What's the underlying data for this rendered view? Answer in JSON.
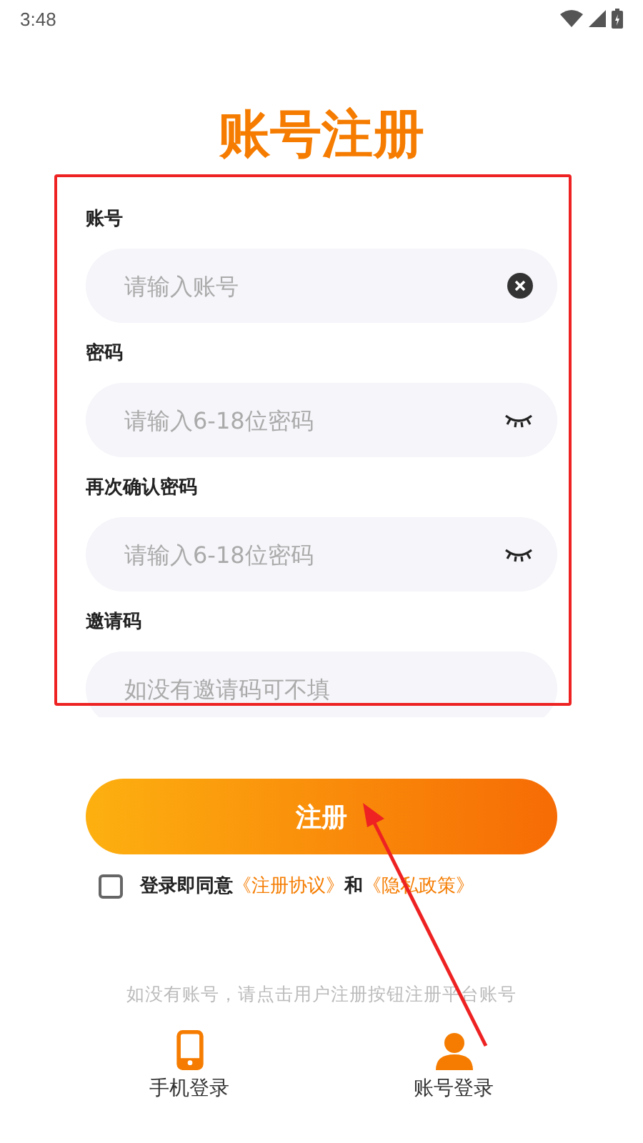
{
  "status_bar": {
    "time": "3:48"
  },
  "title": "账号注册",
  "fields": [
    {
      "kind": "clearable",
      "label": "账号",
      "placeholder": "请输入账号"
    },
    {
      "kind": "password",
      "label": "密码",
      "placeholder": "请输入6-18位密码"
    },
    {
      "kind": "password",
      "label": "再次确认密码",
      "placeholder": "请输入6-18位密码"
    },
    {
      "kind": "plain",
      "label": "邀请码",
      "placeholder": "如没有邀请码可不填"
    }
  ],
  "submit_button": "注册",
  "agreement": {
    "checked": false,
    "text": "登录即同意",
    "link_1": "《注册协议》",
    "joiner": "和",
    "link_2": "《隐私政策》"
  },
  "hint": "如没有账号，请点击用户注册按钮注册平台账号",
  "bottom_options": [
    {
      "kind": "phone",
      "label": "手机登录"
    },
    {
      "kind": "person",
      "label": "账号登录"
    }
  ]
}
